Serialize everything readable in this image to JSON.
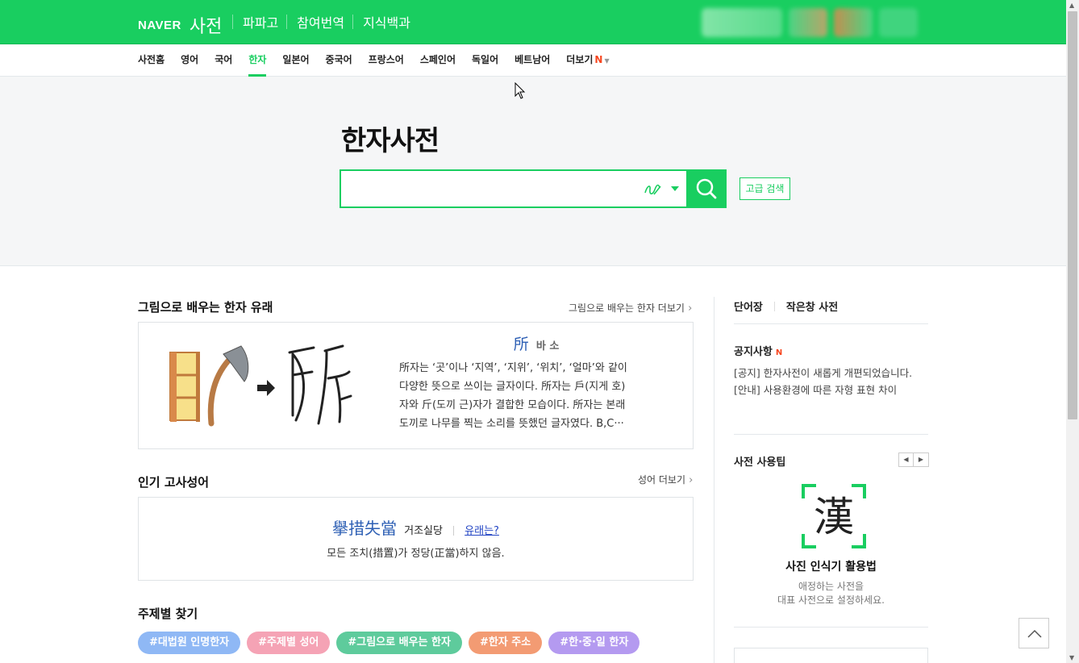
{
  "header": {
    "logo": "NAVER",
    "service": "사전",
    "nav": [
      "파파고",
      "참여번역",
      "지식백과"
    ],
    "brand_color": "#19ce60"
  },
  "langnav": {
    "items": [
      "사전홈",
      "영어",
      "국어",
      "한자",
      "일본어",
      "중국어",
      "프랑스어",
      "스페인어",
      "독일어",
      "베트남어",
      "더보기"
    ],
    "active_index": 3,
    "more_badge": "N"
  },
  "search": {
    "title": "한자사전",
    "placeholder": "",
    "advanced_label": "고급 검색",
    "handwriting_icon": "handwriting-icon",
    "search_icon": "search-icon"
  },
  "origin": {
    "title": "그림으로 배우는 한자 유래",
    "more": "그림으로 배우는 한자 더보기",
    "hanja": "所",
    "reading": "바 소",
    "lines": [
      "所자는 ‘곳’이나 ‘지역’, ‘지위’, ‘위치’, ‘얼마’와 같이",
      "다양한 뜻으로 쓰이는 글자이다. 所자는 戶(지게 호)",
      "자와 斤(도끼 근)자가 결합한 모습이다. 所자는 본래",
      "도끼로 나무를 찍는 소리를 뜻했던 글자였다. B,C···"
    ]
  },
  "idiom": {
    "title": "인기 고사성어",
    "more": "성어 더보기",
    "hanja": "擧措失當",
    "reading": "거조실당",
    "link": "유래는?",
    "meaning": "모든 조치(措置)가 정당(正當)하지 않음."
  },
  "themes": {
    "title": "주제별 찾기",
    "tags": [
      {
        "label": "#대법원 인명한자",
        "color": "#8fb8f5"
      },
      {
        "label": "#주제별 성어",
        "color": "#f5a3b5"
      },
      {
        "label": "#그림으로 배우는 한자",
        "color": "#5ecb9c"
      },
      {
        "label": "#한자 주소",
        "color": "#f39b73"
      },
      {
        "label": "#한·중·일 한자",
        "color": "#b49af0"
      }
    ]
  },
  "sidebar": {
    "tabs": [
      "단어장",
      "작은창 사전"
    ],
    "notice_title": "공지사항",
    "notice_badge": "N",
    "notices": [
      "[공지] 한자사전이 새롭게 개편되었습니다.",
      "[안내] 사용환경에 따른 자형 표현 차이"
    ],
    "tip_title": "사전 사용팁",
    "tip_char": "漢",
    "tip_head": "사진 인식기 활용법",
    "tip_desc": [
      "애정하는 사전을",
      "대표 사전으로 설정하세요."
    ]
  }
}
